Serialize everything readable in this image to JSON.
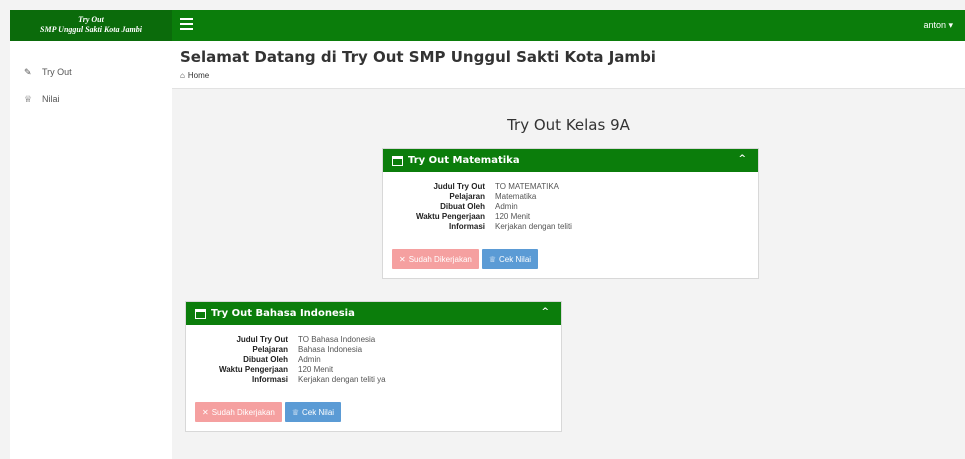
{
  "app": {
    "brand_line1": "Try Out",
    "brand_line2": "SMP Unggul Sakti Kota Jambi",
    "user_label": "anton ▾"
  },
  "sidebar": {
    "items": [
      {
        "label": "Try Out",
        "icon": "pencil-icon"
      },
      {
        "label": "Nilai",
        "icon": "trophy-icon"
      }
    ]
  },
  "header": {
    "title": "Selamat Datang di Try Out SMP Unggul Sakti Kota Jambi",
    "breadcrumb": "Home"
  },
  "section": {
    "title": "Try Out Kelas 9A"
  },
  "labels": {
    "judul": "Judul Try Out",
    "pelajaran": "Pelajaran",
    "dibuat": "Dibuat Oleh",
    "waktu": "Waktu Pengerjaan",
    "informasi": "Informasi",
    "done_btn": "Sudah Dikerjakan",
    "nilai_btn": "Cek Nilai"
  },
  "cards": [
    {
      "title": "Try Out Matematika",
      "judul": "TO MATEMATIKA",
      "pelajaran": "Matematika",
      "dibuat": "Admin",
      "waktu": "120 Menit",
      "informasi": "Kerjakan dengan teliti"
    },
    {
      "title": "Try Out Bahasa Indonesia",
      "judul": "TO Bahasa Indonesia",
      "pelajaran": "Bahasa Indonesia",
      "dibuat": "Admin",
      "waktu": "120 Menit",
      "informasi": "Kerjakan dengan teliti ya"
    }
  ],
  "colors": {
    "brand_green": "#0b7d0b",
    "danger_light": "#f5a0a0",
    "info": "#5b9bd5"
  }
}
